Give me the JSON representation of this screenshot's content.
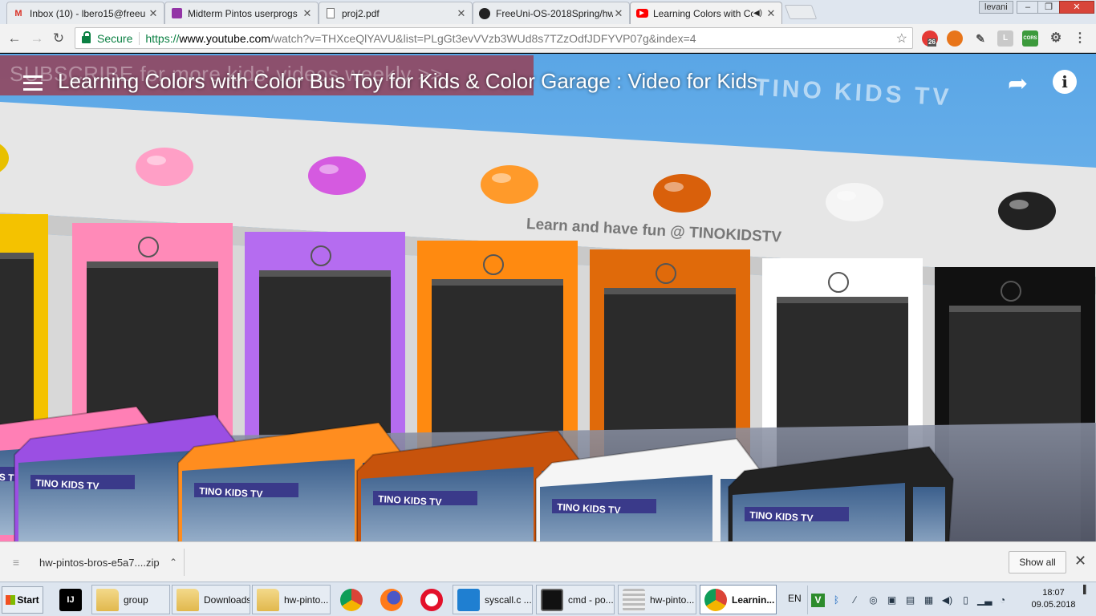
{
  "browser": {
    "tabs": [
      {
        "title": "Inbox (10) - lbero15@freeu",
        "icon": "gmail-icon",
        "icon_color": "#d93025"
      },
      {
        "title": "Midterm Pintos userprogs",
        "icon": "classroom-icon",
        "icon_color": "#9334a6"
      },
      {
        "title": "proj2.pdf",
        "icon": "document-icon",
        "icon_color": "#777777"
      },
      {
        "title": "FreeUni-OS-2018Spring/hw",
        "icon": "github-icon",
        "icon_color": "#222222"
      },
      {
        "title": "Learning Colors with Co",
        "icon": "youtube-icon",
        "icon_color": "#ff0000",
        "active": true
      }
    ],
    "user": "levani",
    "window_controls": {
      "minimize": "–",
      "maximize": "❐",
      "close": "✕"
    },
    "omnibox": {
      "security_label": "Secure",
      "url_scheme": "https://",
      "url_host": "www.youtube.com",
      "url_path": "/watch?v=THXceQlYAVU&list=PLgGt3evVVzb3WUd8s7TZzOdfJDFYVP07g&index=4"
    },
    "extensions": [
      {
        "name": "adblock-icon",
        "badge": "26"
      },
      {
        "name": "basketball-icon"
      },
      {
        "name": "eyedropper-icon"
      },
      {
        "name": "extension-l-icon",
        "label": "L"
      },
      {
        "name": "cors-icon",
        "label": "CORS"
      },
      {
        "name": "settings-gear-icon"
      },
      {
        "name": "chrome-menu-icon"
      }
    ]
  },
  "video": {
    "title": "Learning Colors with Color Bus Toy for Kids & Color Garage : Video for Kids",
    "subscribe_banner": "SUBSCRIBE for more kids' videos weekly >>",
    "watermark": "Learn and have fun @ TINOKIDSTV",
    "logo_watermark": "TINO KIDS TV",
    "bus_label": "TINO KIDS TV",
    "garage_colors": [
      "#f4c200",
      "#ff8ab8",
      "#b56cf0",
      "#ff8a10",
      "#e06a0a",
      "#ffffff",
      "#111111"
    ],
    "light_colors": [
      "#e8c000",
      "#ff9fc6",
      "#d55ae0",
      "#ff9a2a",
      "#d9600b",
      "#f5f5f5",
      "#222222"
    ],
    "bus_colors": [
      "#ff7fb5",
      "#9b4fe3",
      "#ff8d1f",
      "#c7530c",
      "#f5f5f5",
      "#222222"
    ]
  },
  "download_bar": {
    "file": "hw-pintos-bros-e5a7....zip",
    "show_all": "Show all"
  },
  "taskbar": {
    "start": "Start",
    "items": [
      {
        "label": "",
        "icon": "intellij-icon"
      },
      {
        "label": "group",
        "icon": "folder-icon"
      },
      {
        "label": "Downloads",
        "icon": "downloads-folder-icon"
      },
      {
        "label": "hw-pinto...",
        "icon": "folder-icon"
      },
      {
        "label": "",
        "icon": "chrome-icon"
      },
      {
        "label": "",
        "icon": "firefox-icon"
      },
      {
        "label": "",
        "icon": "opera-icon"
      },
      {
        "label": "syscall.c ...",
        "icon": "vscode-icon"
      },
      {
        "label": "cmd - po...",
        "icon": "cmd-icon"
      },
      {
        "label": "hw-pinto...",
        "icon": "app-icon"
      },
      {
        "label": "Learnin...",
        "icon": "chrome-icon",
        "active": true
      }
    ],
    "language": "EN",
    "time": "18:07",
    "date": "09.05.2018"
  }
}
